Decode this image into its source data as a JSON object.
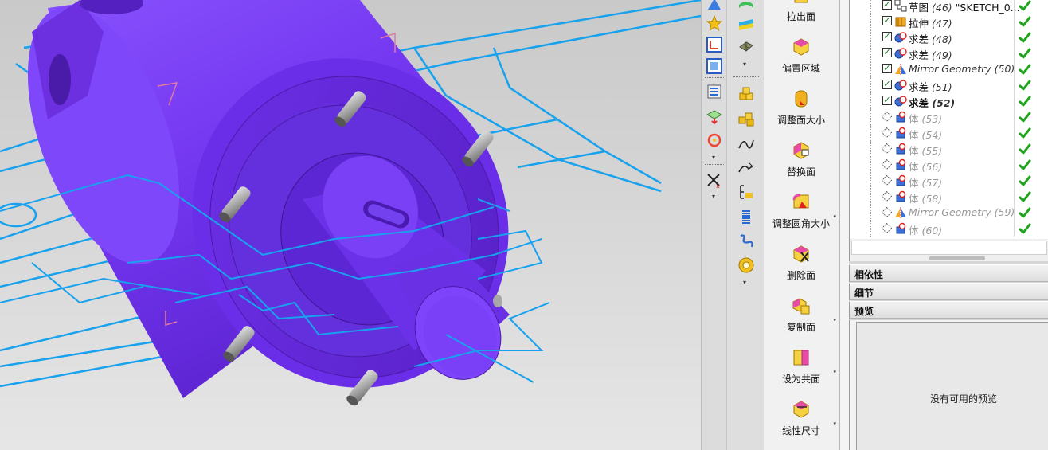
{
  "commands": [
    {
      "label": "拉出面",
      "dropdown": false,
      "icon": "extrude-face-icon"
    },
    {
      "label": "偏置区域",
      "dropdown": false,
      "icon": "offset-region-icon"
    },
    {
      "label": "调整面大小",
      "dropdown": false,
      "icon": "resize-face-icon"
    },
    {
      "label": "替换面",
      "dropdown": false,
      "icon": "replace-face-icon"
    },
    {
      "label": "调整圆角大小",
      "dropdown": true,
      "icon": "resize-blend-icon"
    },
    {
      "label": "删除面",
      "dropdown": false,
      "icon": "delete-face-icon"
    },
    {
      "label": "复制面",
      "dropdown": true,
      "icon": "copy-face-icon"
    },
    {
      "label": "设为共面",
      "dropdown": true,
      "icon": "make-coplanar-icon"
    },
    {
      "label": "线性尺寸",
      "dropdown": true,
      "icon": "linear-dimension-icon"
    }
  ],
  "navigator": {
    "rows": [
      {
        "type": "草图",
        "num": "(46)",
        "extra": "\"SKETCH_0...",
        "icon": "sketch-icon",
        "checked": true,
        "status": "ok",
        "dim": false,
        "bold": false,
        "italic": false
      },
      {
        "type": "拉伸",
        "num": "(47)",
        "extra": "",
        "icon": "extrude-icon",
        "checked": true,
        "status": "ok",
        "dim": false,
        "bold": false,
        "italic": false
      },
      {
        "type": "求差",
        "num": "(48)",
        "extra": "",
        "icon": "subtract-icon",
        "checked": true,
        "status": "ok",
        "dim": false,
        "bold": false,
        "italic": false
      },
      {
        "type": "求差",
        "num": "(49)",
        "extra": "",
        "icon": "subtract-icon",
        "checked": true,
        "status": "ok",
        "dim": false,
        "bold": false,
        "italic": false
      },
      {
        "type": "Mirror Geometry",
        "num": "(50)",
        "extra": "",
        "icon": "mirror-geometry-icon",
        "checked": true,
        "status": "ok",
        "dim": false,
        "bold": false,
        "italic": true
      },
      {
        "type": "求差",
        "num": "(51)",
        "extra": "",
        "icon": "subtract-icon",
        "checked": true,
        "status": "ok",
        "dim": false,
        "bold": false,
        "italic": false
      },
      {
        "type": "求差",
        "num": "(52)",
        "extra": "",
        "icon": "subtract-icon",
        "checked": true,
        "status": "ok",
        "dim": false,
        "bold": true,
        "italic": false
      },
      {
        "type": "体",
        "num": "(53)",
        "extra": "",
        "icon": "body-icon",
        "checked": false,
        "status": "ok",
        "dim": true,
        "bold": false,
        "italic": false
      },
      {
        "type": "体",
        "num": "(54)",
        "extra": "",
        "icon": "body-icon",
        "checked": false,
        "status": "ok",
        "dim": true,
        "bold": false,
        "italic": false
      },
      {
        "type": "体",
        "num": "(55)",
        "extra": "",
        "icon": "body-icon",
        "checked": false,
        "status": "ok",
        "dim": true,
        "bold": false,
        "italic": false
      },
      {
        "type": "体",
        "num": "(56)",
        "extra": "",
        "icon": "body-icon",
        "checked": false,
        "status": "ok",
        "dim": true,
        "bold": false,
        "italic": false
      },
      {
        "type": "体",
        "num": "(57)",
        "extra": "",
        "icon": "body-icon",
        "checked": false,
        "status": "ok",
        "dim": true,
        "bold": false,
        "italic": false
      },
      {
        "type": "体",
        "num": "(58)",
        "extra": "",
        "icon": "body-icon",
        "checked": false,
        "status": "ok",
        "dim": true,
        "bold": false,
        "italic": false
      },
      {
        "type": "Mirror Geometry",
        "num": "(59)",
        "extra": "",
        "icon": "mirror-geometry-icon",
        "checked": false,
        "status": "ok",
        "dim": true,
        "bold": false,
        "italic": true
      },
      {
        "type": "体",
        "num": "(60)",
        "extra": "",
        "icon": "body-icon",
        "checked": false,
        "status": "ok",
        "dim": true,
        "bold": false,
        "italic": false
      }
    ]
  },
  "sections": {
    "dependencies": "相依性",
    "details": "细节",
    "preview": "预览"
  },
  "preview": {
    "message": "没有可用的预览"
  },
  "colors": {
    "model_purple": "#7a3df2",
    "model_dark": "#5b23c8",
    "sketch_blue": "#18a2ee",
    "check_green": "#1aa51a"
  }
}
